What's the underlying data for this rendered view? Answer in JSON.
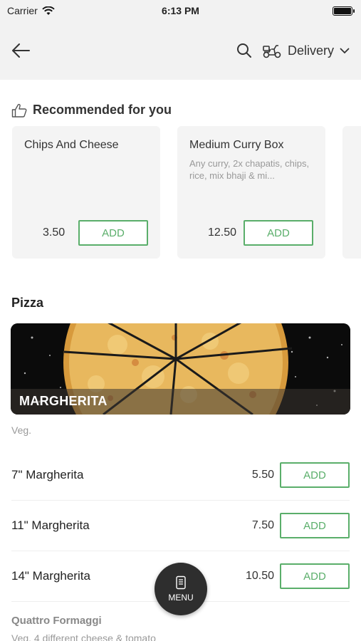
{
  "status": {
    "carrier": "Carrier",
    "time": "6:13 PM"
  },
  "header": {
    "delivery_label": "Delivery"
  },
  "recommended": {
    "title": "Recommended for you",
    "items": [
      {
        "name": "Chips And Cheese",
        "description": "",
        "price": "3.50",
        "add_label": "ADD"
      },
      {
        "name": "Medium Curry Box",
        "description": "Any curry, 2x chapatis, chips, rice, mix bhaji & mi...",
        "price": "12.50",
        "add_label": "ADD"
      }
    ]
  },
  "section": {
    "title": "Pizza",
    "banner_label": "MARGHERITA",
    "note": "Veg.",
    "items": [
      {
        "name": "7\" Margherita",
        "price": "5.50",
        "add_label": "ADD"
      },
      {
        "name": "11\" Margherita",
        "price": "7.50",
        "add_label": "ADD"
      },
      {
        "name": "14\" Margherita",
        "price": "10.50",
        "add_label": "ADD"
      }
    ]
  },
  "next_section": {
    "name": "Quattro Formaggi",
    "description": "Veg. 4 different cheese & tomato"
  },
  "menu_button": {
    "label": "MENU"
  },
  "colors": {
    "accent": "#5aae6a",
    "header_bg": "#f2f2f2",
    "fab_bg": "#2e2e2e"
  }
}
